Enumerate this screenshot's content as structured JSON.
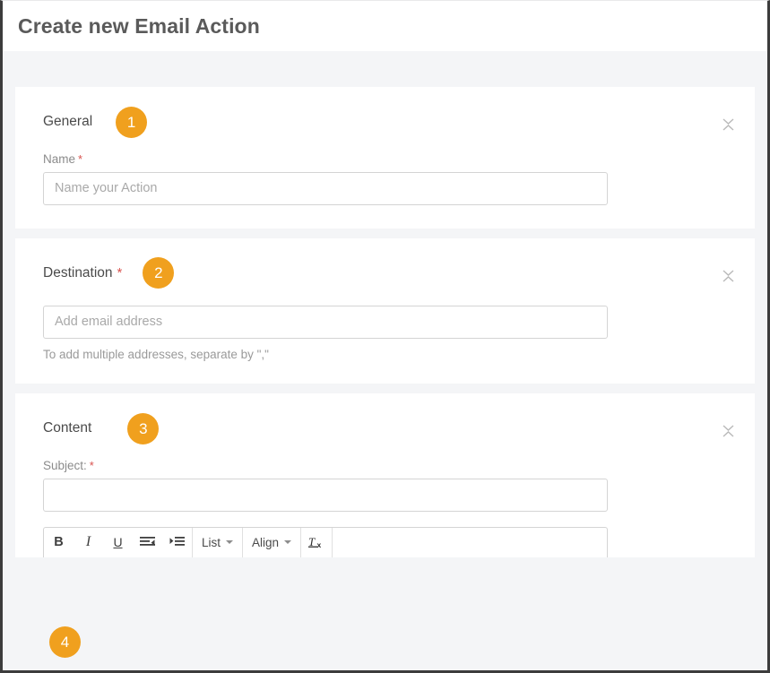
{
  "header": {
    "title": "Create new Email Action"
  },
  "colors": {
    "badge": "#f0a01e",
    "required_star": "#d9534f",
    "page_background": "#f4f5f7",
    "card_background": "#ffffff",
    "title_text": "#5a5a5a"
  },
  "sections": [
    {
      "title": "General",
      "required": false,
      "badge": "1",
      "collapse_icon": "collapse-chevrons-icon",
      "field_label": "Name",
      "field_required_star": "*",
      "input_placeholder": "Name your Action",
      "input_value": ""
    },
    {
      "title": "Destination",
      "required": true,
      "required_star": "*",
      "badge": "2",
      "collapse_icon": "collapse-chevrons-icon",
      "input_placeholder": "Add email address",
      "input_value": "",
      "helper_text": "To add multiple addresses, separate by \",\""
    },
    {
      "title": "Content",
      "required": false,
      "badge": "3",
      "collapse_icon": "collapse-chevrons-icon",
      "field_label": "Subject:",
      "field_required_star": "*",
      "input_placeholder": "",
      "input_value": ""
    }
  ],
  "editor_toolbar": {
    "bold_label": "B",
    "italic_label": "I",
    "underline_label": "U",
    "outdent_icon": "outdent-icon",
    "indent_icon": "indent-icon",
    "list_label": "List",
    "align_label": "Align",
    "remove_format_label": "Tx"
  },
  "floating_badge": {
    "label": "4"
  }
}
